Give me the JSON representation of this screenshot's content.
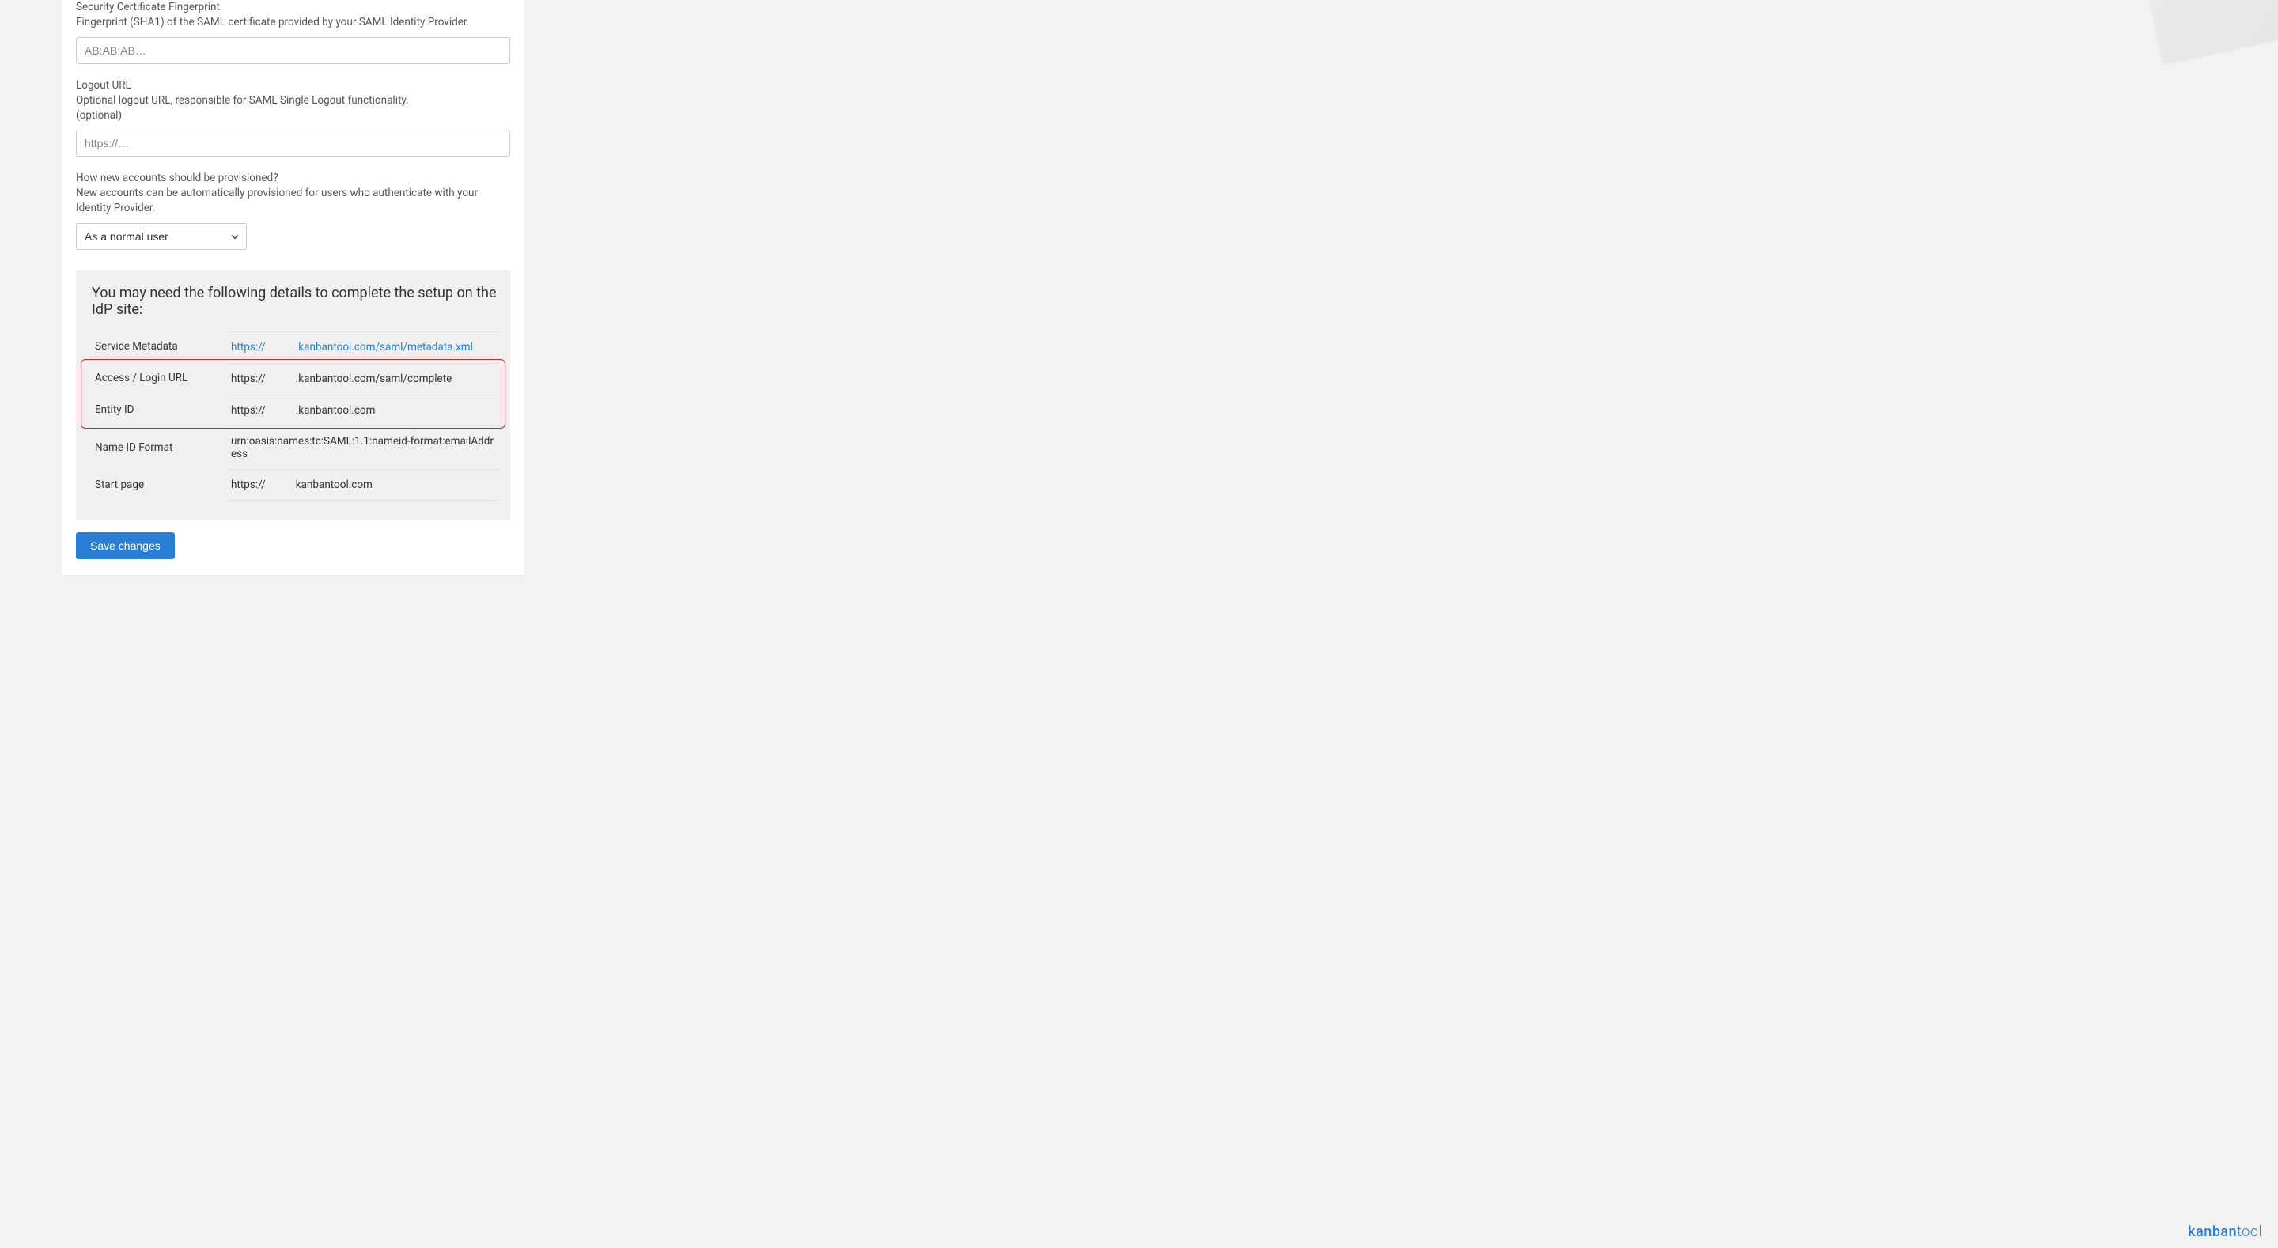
{
  "fields": {
    "fingerprint": {
      "label": "Security Certificate Fingerprint",
      "help": "Fingerprint (SHA1) of the SAML certificate provided by your SAML Identity Provider.",
      "placeholder": "AB:AB:AB…"
    },
    "logout_url": {
      "label": "Logout URL",
      "help": "Optional logout URL, responsible for SAML Single Logout functionality.",
      "help2": "(optional)",
      "placeholder": "https://…"
    },
    "provisioning": {
      "label": "How new accounts should be provisioned?",
      "help": "New accounts can be automatically provisioned for users who authenticate with your Identity Provider.",
      "value": "As a normal user"
    }
  },
  "info_panel": {
    "heading": "You may need the following details to complete the setup on the IdP site:",
    "rows": [
      {
        "key": "Service Metadata",
        "prefix": "https://",
        "suffix": ".kanbantool.com/saml/metadata.xml",
        "link": true
      },
      {
        "key": "Access / Login URL",
        "prefix": "https://",
        "suffix": ".kanbantool.com/saml/complete",
        "link": false
      },
      {
        "key": "Entity ID",
        "prefix": "https://",
        "suffix": ".kanbantool.com",
        "link": false
      },
      {
        "key": "Name ID Format",
        "full": "urn:oasis:names:tc:SAML:1.1:nameid-format:emailAddress"
      },
      {
        "key": "Start page",
        "prefix": "https://",
        "suffix": "kanbantool.com",
        "link": false
      }
    ]
  },
  "actions": {
    "save": "Save changes"
  },
  "brand": {
    "part1": "kanban",
    "part2": "tool"
  }
}
